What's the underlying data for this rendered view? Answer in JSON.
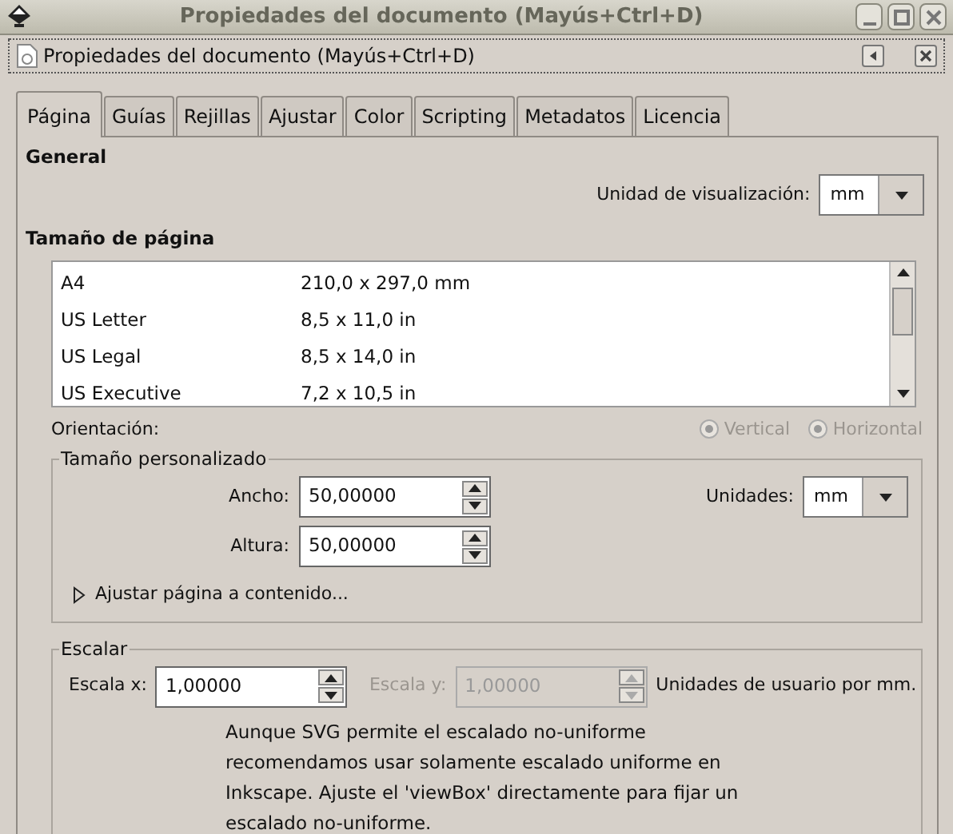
{
  "window": {
    "title": "Propiedades del documento (Mayús+Ctrl+D)"
  },
  "dock": {
    "title": "Propiedades del documento (Mayús+Ctrl+D)"
  },
  "tabs": [
    {
      "label": "Página",
      "selected": true
    },
    {
      "label": "Guías",
      "selected": false
    },
    {
      "label": "Rejillas",
      "selected": false
    },
    {
      "label": "Ajustar",
      "selected": false
    },
    {
      "label": "Color",
      "selected": false
    },
    {
      "label": "Scripting",
      "selected": false
    },
    {
      "label": "Metadatos",
      "selected": false
    },
    {
      "label": "Licencia",
      "selected": false
    }
  ],
  "general": {
    "heading": "General",
    "display_units": {
      "label": "Unidad de visualización:",
      "value": "mm"
    }
  },
  "page_size": {
    "heading": "Tamaño de página",
    "rows": [
      {
        "name": "A4",
        "size": "210,0 x 297,0 mm"
      },
      {
        "name": "US Letter",
        "size": "8,5 x 11,0 in"
      },
      {
        "name": "US Legal",
        "size": "8,5 x 14,0 in"
      },
      {
        "name": "US Executive",
        "size": "7,2 x 10,5 in"
      }
    ]
  },
  "orientation": {
    "label": "Orientación:",
    "options": [
      {
        "label": "Vertical",
        "selected": true,
        "disabled": true
      },
      {
        "label": "Horizontal",
        "selected": true,
        "disabled": true
      }
    ]
  },
  "custom_size": {
    "legend": "Tamaño personalizado",
    "width": {
      "label": "Ancho:",
      "value": "50,00000"
    },
    "height": {
      "label": "Altura:",
      "value": "50,00000"
    },
    "units": {
      "label": "Unidades:",
      "value": "mm"
    },
    "expander": {
      "label": "Ajustar página a contenido...",
      "expanded": false
    }
  },
  "scale": {
    "legend": "Escalar",
    "scale_x": {
      "label": "Escala x:",
      "value": "1,00000",
      "disabled": false
    },
    "scale_y": {
      "label": "Escala y:",
      "value": "1,00000",
      "disabled": true
    },
    "units_note": "Unidades de usuario por mm.",
    "help": "Aunque SVG permite el escalado no-uniforme recomendamos usar solamente escalado uniforme en Inkscape. Ajuste el 'viewBox' directamente para fijar un escalado no-uniforme."
  }
}
